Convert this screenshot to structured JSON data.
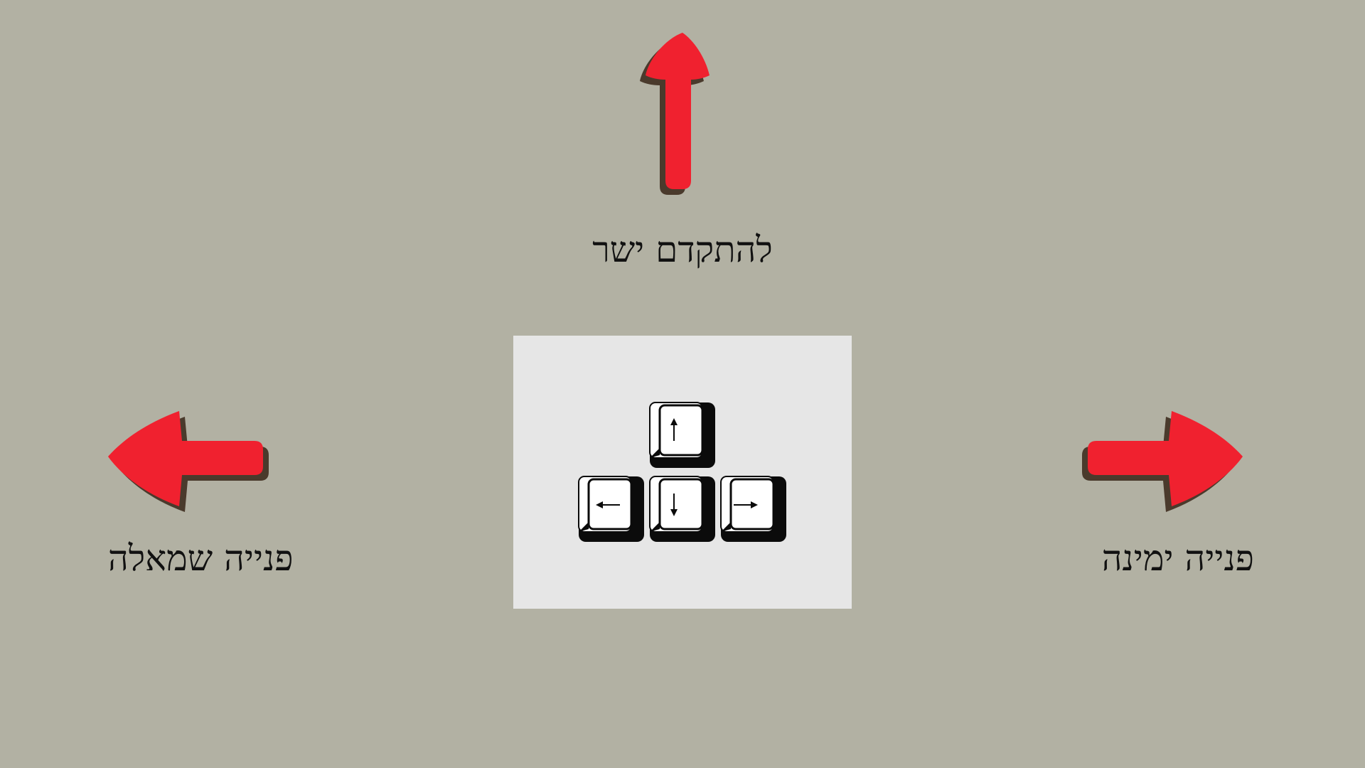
{
  "labels": {
    "forward": "להתקדם ישר",
    "left": "פנייה שמאלה",
    "right": "פנייה ימינה"
  },
  "keys": [
    {
      "name": "up",
      "icon": "arrow-up-icon"
    },
    {
      "name": "left",
      "icon": "arrow-left-icon"
    },
    {
      "name": "down",
      "icon": "arrow-down-icon"
    },
    {
      "name": "right",
      "icon": "arrow-right-icon"
    }
  ],
  "colors": {
    "background": "#b2b1a3",
    "arrow_fill": "#f0212f",
    "arrow_shadow": "#4a3a2c",
    "panel": "#e6e6e6",
    "text": "#111111"
  }
}
